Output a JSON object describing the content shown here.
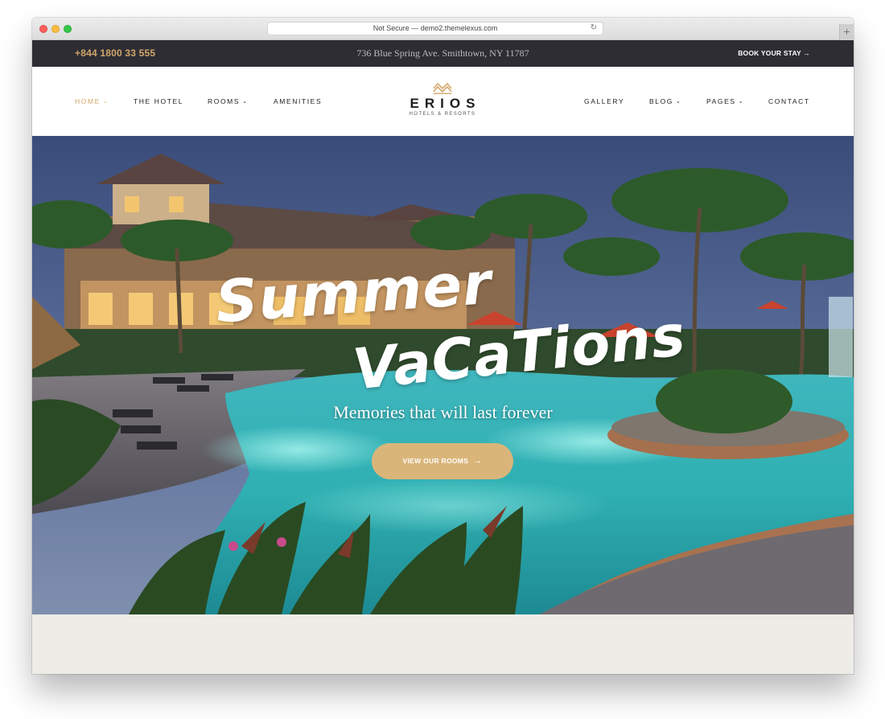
{
  "browser": {
    "url_text": "Not Secure — demo2.themelexus.com",
    "reload_glyph": "↻",
    "new_tab_glyph": "+"
  },
  "topbar": {
    "phone": "+844 1800 33 555",
    "address": "736 Blue Spring Ave. Smithtown, NY 11787",
    "book_label": "BOOK YOUR STAY",
    "book_arrow": "→"
  },
  "nav": {
    "left": [
      {
        "label": "HOME",
        "caret": "⌄",
        "active": true
      },
      {
        "label": "THE HOTEL"
      },
      {
        "label": "ROOMS",
        "caret": "⌄"
      },
      {
        "label": "AMENITIES"
      }
    ],
    "right": [
      {
        "label": "GALLERY"
      },
      {
        "label": "BLOG",
        "caret": "⌄"
      },
      {
        "label": "PAGES",
        "caret": "⌄"
      },
      {
        "label": "CONTACT"
      }
    ]
  },
  "logo": {
    "name": "ERIOS",
    "subtitle": "HOTELS & RESORTS",
    "icon": "crown-icon"
  },
  "hero": {
    "headline_line1": "Summer",
    "headline_line2": "VaCaTions",
    "tagline": "Memories that will last forever",
    "cta_label": "VIEW OUR ROOMS",
    "cta_arrow": "→"
  },
  "colors": {
    "accent": "#d2a669",
    "topbar_bg": "#2e2d34",
    "cta_bg": "#dab57a",
    "strip_bg": "#edece7"
  }
}
